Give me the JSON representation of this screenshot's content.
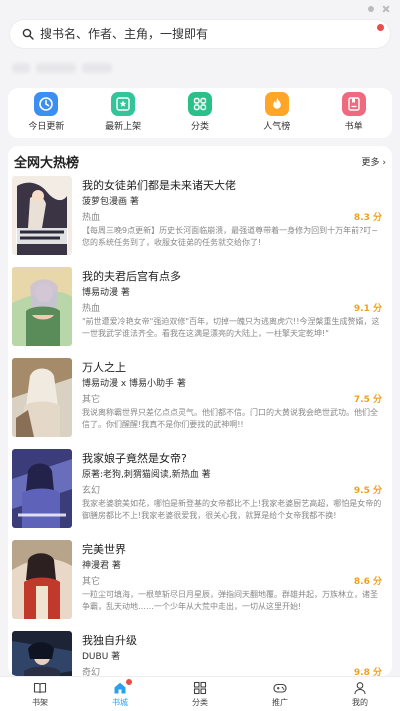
{
  "search": {
    "placeholder": "搜书名、作者、主角，一搜即有"
  },
  "quick_links": [
    {
      "label": "今日更新",
      "icon": "clock-icon",
      "color": "#3a8ff0"
    },
    {
      "label": "最新上架",
      "icon": "star-box-icon",
      "color": "#34c49a"
    },
    {
      "label": "分类",
      "icon": "grid-icon",
      "color": "#2bc08a"
    },
    {
      "label": "人气榜",
      "icon": "flame-icon",
      "color": "#ffa629"
    },
    {
      "label": "书单",
      "icon": "bookmark-list-icon",
      "color": "#f06a7f"
    }
  ],
  "hot_list": {
    "title": "全网大热榜",
    "more": "更多",
    "books": [
      {
        "title": "我的女徒弟们都是未来诸天大佬",
        "author": "菠萝包漫画 著",
        "genre": "热血",
        "score": "8.3 分",
        "desc": "【每周三晚9点更新】历史长河面临崩溃，最强道尊带着一身修为回到十万年前?叮~您的系统任务到了，收服女徒弟的任务就交给你了!"
      },
      {
        "title": "我的夫君后宫有点多",
        "author": "博易动漫 著",
        "genre": "热血",
        "score": "9.1 分",
        "desc": "\"前世遭爱冷艳女帝\"强迫双修\"百年，切掉一魄只为逃离虎穴!!今涅槃重生成赘婿，这一世我武学谁法齐全。看我在这满是漂亮的大陆上，一柱擎天定乾坤!\""
      },
      {
        "title": "万人之上",
        "author": "博易动漫 x 博易小助手 著",
        "genre": "其它",
        "score": "7.5 分",
        "desc": "我说离称霸世界只差亿点点灵气。他们都不信。门口的大黄说我会绝世武功。他们全信了。你们醒醒!我真不是你们要找的武神啊!!"
      },
      {
        "title": "我家娘子竟然是女帝?",
        "author": "原著:老狗,刺猬猫阅读,新热血 著",
        "genre": "玄幻",
        "score": "9.5 分",
        "desc": "我家老婆貌美如花，哪怕是新登基的女帝都比不上!我家老婆厨艺高超，哪怕是女帝的御膳房都比不上!我家老婆很爱我，很关心我，就算是给个女帝我都不换!"
      },
      {
        "title": "完美世界",
        "author": "神漫君 著",
        "genre": "其它",
        "score": "8.6 分",
        "desc": "一粒尘可填海，一根草斩尽日月星辰，弹指间天翻地覆。群雄并起，万族林立，诸圣争霸，乱天动地……一个少年从大荒中走出，一切从这里开始!"
      },
      {
        "title": "我独自升级",
        "author": "DUBU 著",
        "genre": "奇幻",
        "score": "9.8 分",
        "desc": ""
      }
    ]
  },
  "tabbar": [
    {
      "label": "书架",
      "icon": "book-open-icon"
    },
    {
      "label": "书城",
      "icon": "home-icon"
    },
    {
      "label": "分类",
      "icon": "grid-icon"
    },
    {
      "label": "推广",
      "icon": "gamepad-icon"
    },
    {
      "label": "我的",
      "icon": "person-icon"
    }
  ]
}
